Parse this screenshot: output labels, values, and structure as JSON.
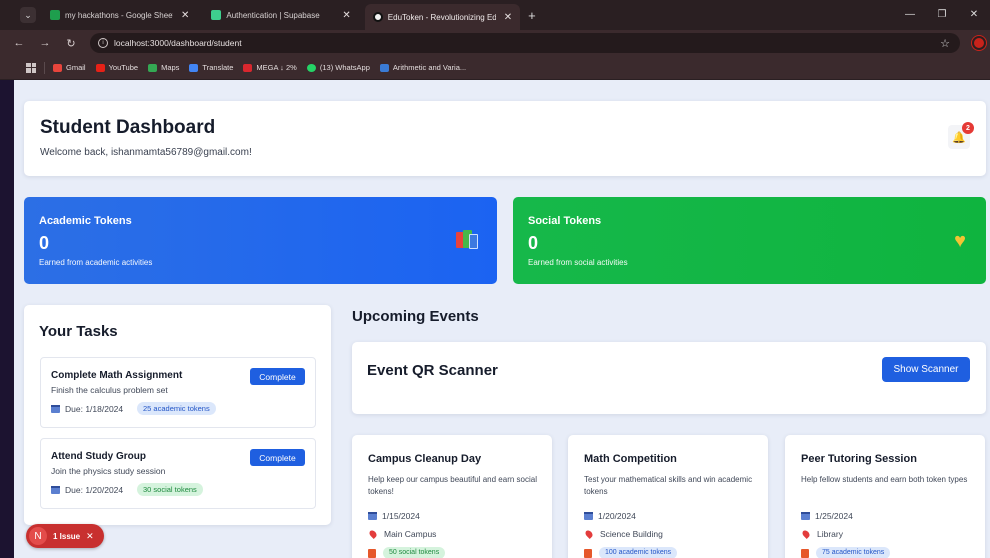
{
  "browser": {
    "tabs": [
      {
        "title": "my hackathons - Google Sheets",
        "color": "#1e9e4d"
      },
      {
        "title": "Authentication | Supabase",
        "color": "#3ecf8e"
      },
      {
        "title": "EduToken - Revolutionizing Edu",
        "color": "#111111"
      }
    ],
    "new_tab": "+",
    "url": "localhost:3000/dashboard/student",
    "bookmarks": [
      {
        "label": "Gmail",
        "color": "#e8453c"
      },
      {
        "label": "YouTube",
        "color": "#e62117"
      },
      {
        "label": "Maps",
        "color": "#34a853"
      },
      {
        "label": "Translate",
        "color": "#4285f4"
      },
      {
        "label": "MEGA ↓ 2%",
        "color": "#d9272e"
      },
      {
        "label": "(13) WhatsApp",
        "color": "#25d366"
      },
      {
        "label": "Arithmetic and Varia...",
        "color": "#3a7bd5"
      }
    ]
  },
  "header": {
    "title": "Student Dashboard",
    "welcome": "Welcome back, ishanmamta56789@gmail.com!",
    "notifications": "2"
  },
  "tokens": {
    "academic": {
      "title": "Academic Tokens",
      "value": "0",
      "subtitle": "Earned from academic activities",
      "color": "#1f66ee"
    },
    "social": {
      "title": "Social Tokens",
      "value": "0",
      "subtitle": "Earned from social activities",
      "color": "#12b545"
    }
  },
  "tasks": {
    "title": "Your Tasks",
    "button_label": "Complete",
    "items": [
      {
        "title": "Complete Math Assignment",
        "desc": "Finish the calculus problem set",
        "due": "Due: 1/18/2024",
        "tokens": "25 academic tokens"
      },
      {
        "title": "Attend Study Group",
        "desc": "Join the physics study session",
        "due": "Due: 1/20/2024",
        "tokens": "30 social tokens"
      }
    ]
  },
  "events": {
    "title": "Upcoming Events",
    "qr_title": "Event QR Scanner",
    "qr_button": "Show Scanner",
    "items": [
      {
        "title": "Campus Cleanup Day",
        "desc": "Help keep our campus beautiful and earn social tokens!",
        "date": "1/15/2024",
        "location": "Main Campus",
        "tokens": "50 social tokens",
        "token_type": "social"
      },
      {
        "title": "Math Competition",
        "desc": "Test your mathematical skills and win academic tokens",
        "date": "1/20/2024",
        "location": "Science Building",
        "tokens": "100 academic tokens",
        "token_type": "academic"
      },
      {
        "title": "Peer Tutoring Session",
        "desc": "Help fellow students and earn both token types",
        "date": "1/25/2024",
        "location": "Library",
        "tokens": "75 academic tokens",
        "token_type": "academic"
      }
    ]
  },
  "issue_badge": {
    "letter": "N",
    "label": "1 Issue"
  }
}
